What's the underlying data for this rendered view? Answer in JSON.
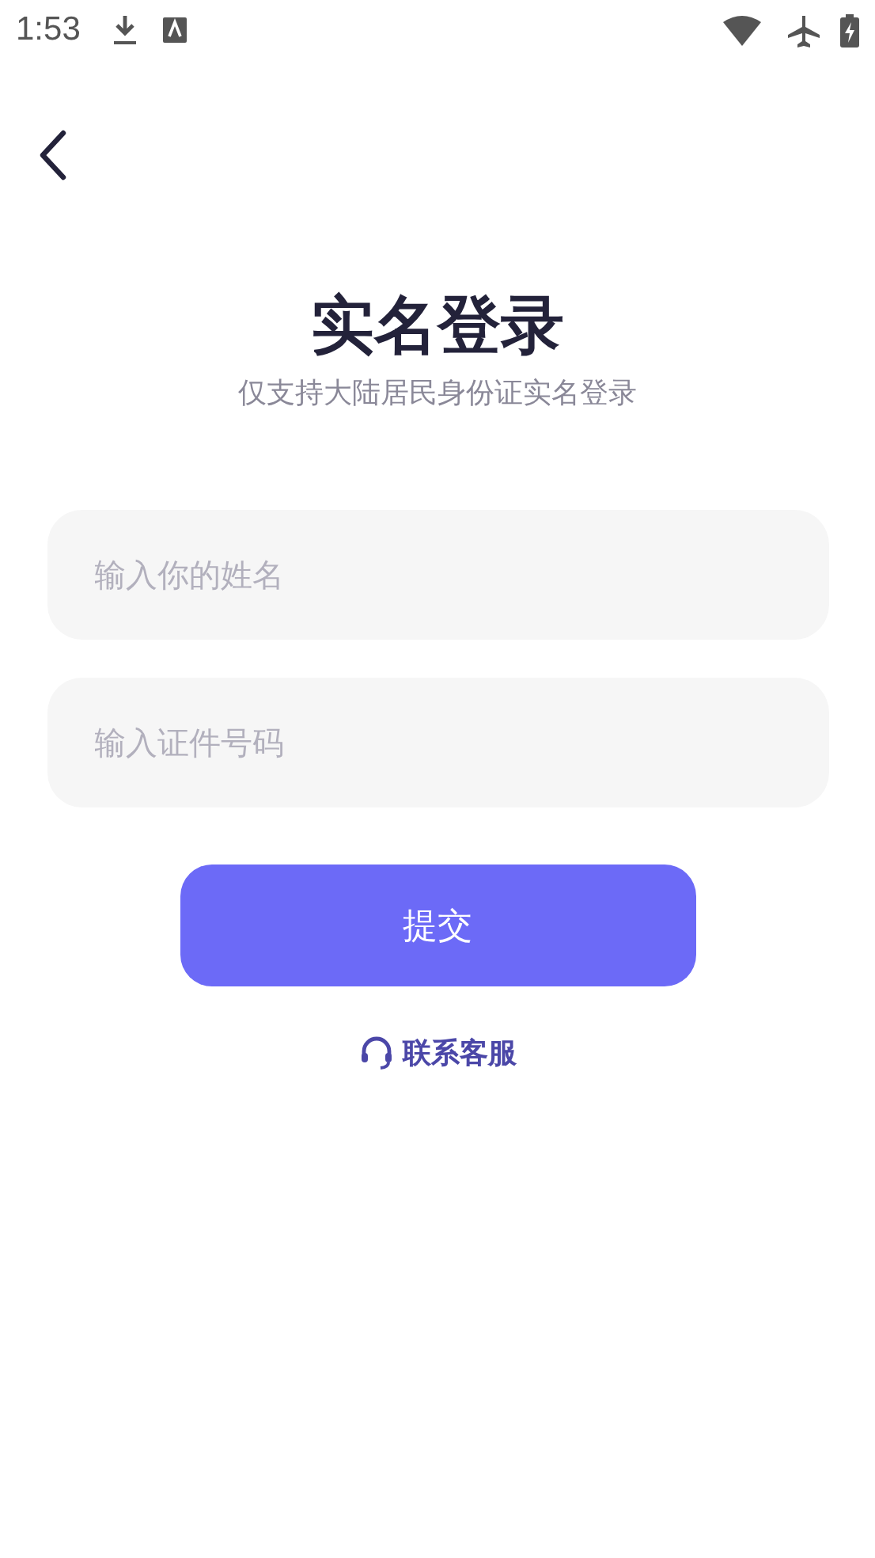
{
  "status_bar": {
    "time": "1:53"
  },
  "title": "实名登录",
  "subtitle": "仅支持大陆居民身份证实名登录",
  "fields": [
    {
      "placeholder": "输入你的姓名"
    },
    {
      "placeholder": "输入证件号码"
    }
  ],
  "submit_button": "提交",
  "support_link": "联系客服"
}
